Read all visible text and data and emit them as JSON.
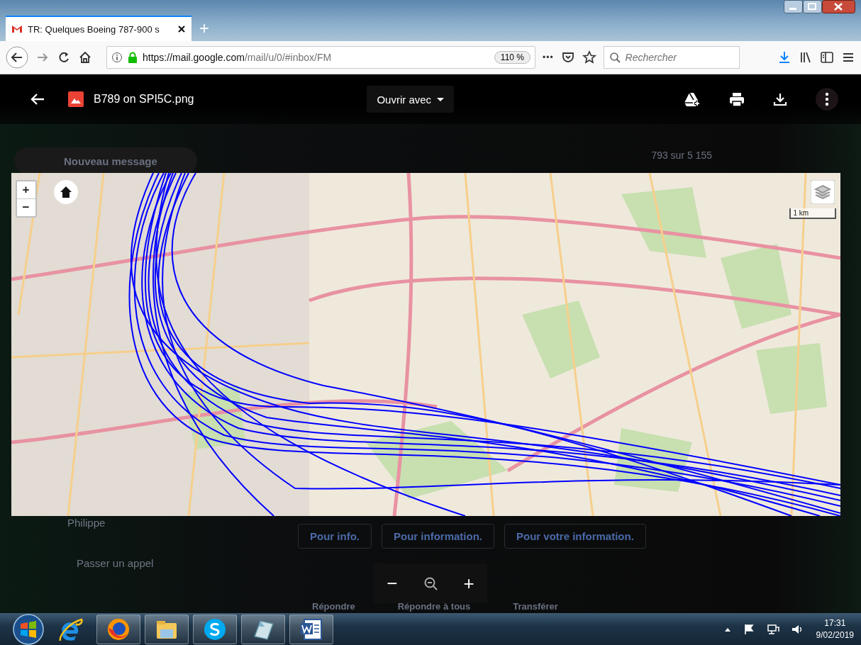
{
  "browser": {
    "tab": {
      "title": "TR: Quelques Boeing 787-900 s",
      "selected": true
    },
    "new_tab": "+",
    "url": {
      "host": "https://mail.google.com",
      "path": "/mail/u/0/#inbox/FM"
    },
    "zoom": "110 %",
    "more": "•••",
    "search": {
      "placeholder": "Rechercher"
    }
  },
  "gmail_background": {
    "compose": "Nouveau message",
    "counter": "793 sur 5 155",
    "contact": "Philippe",
    "call": "Passer un appel",
    "smart_replies": [
      "Pour info.",
      "Pour information.",
      "Pour votre information."
    ],
    "actions": [
      "Répondre",
      "Répondre à tous",
      "Transférer"
    ]
  },
  "viewer": {
    "file_name": "B789 on SPI5C.png",
    "open_with": "Ouvrir avec",
    "map": {
      "zoom_in": "+",
      "zoom_out": "−",
      "scale": "1 km"
    },
    "zoom_bar": {
      "zoom_out": "−",
      "zoom_in": "+"
    }
  },
  "taskbar": {
    "apps": [
      {
        "kind": "ie"
      },
      {
        "kind": "firefox"
      },
      {
        "kind": "explorer"
      },
      {
        "kind": "skype"
      },
      {
        "kind": "notepad"
      },
      {
        "kind": "word"
      }
    ],
    "time": "17:31",
    "date": "9/02/2019"
  }
}
